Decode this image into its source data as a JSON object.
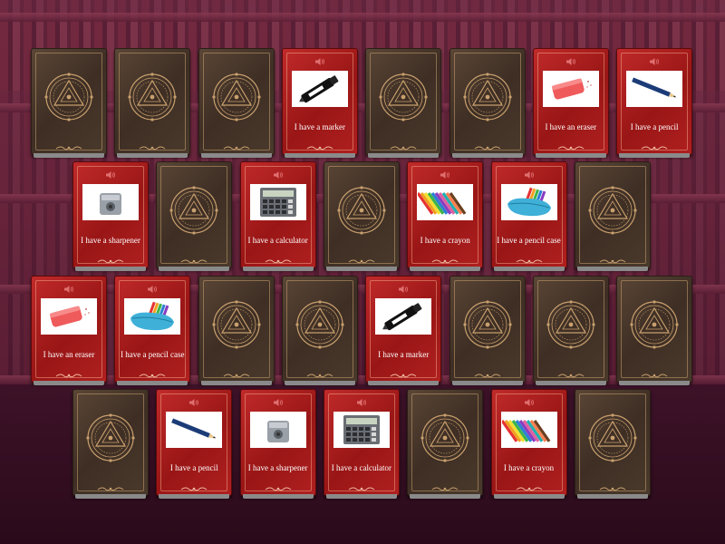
{
  "game": {
    "cards": [
      {
        "row": 0,
        "col": 0,
        "state": "hidden"
      },
      {
        "row": 0,
        "col": 1,
        "state": "hidden"
      },
      {
        "row": 0,
        "col": 2,
        "state": "hidden"
      },
      {
        "row": 0,
        "col": 3,
        "state": "revealed",
        "item": "marker",
        "text": "I have a marker"
      },
      {
        "row": 0,
        "col": 4,
        "state": "hidden"
      },
      {
        "row": 0,
        "col": 5,
        "state": "hidden"
      },
      {
        "row": 0,
        "col": 6,
        "state": "revealed",
        "item": "eraser",
        "text": "I have an eraser"
      },
      {
        "row": 0,
        "col": 7,
        "state": "revealed",
        "item": "pencil",
        "text": "I have a pencil"
      },
      {
        "row": 1,
        "col": 0,
        "state": "revealed",
        "item": "sharpener",
        "text": "I have a sharpener"
      },
      {
        "row": 1,
        "col": 1,
        "state": "hidden"
      },
      {
        "row": 1,
        "col": 2,
        "state": "revealed",
        "item": "calculator",
        "text": "I have a calculator"
      },
      {
        "row": 1,
        "col": 3,
        "state": "hidden"
      },
      {
        "row": 1,
        "col": 4,
        "state": "revealed",
        "item": "crayon",
        "text": "I have a crayon"
      },
      {
        "row": 1,
        "col": 5,
        "state": "revealed",
        "item": "pencil-case",
        "text": "I have a pencil case"
      },
      {
        "row": 1,
        "col": 6,
        "state": "hidden"
      },
      {
        "row": 2,
        "col": 0,
        "state": "revealed",
        "item": "eraser",
        "text": "I have an eraser"
      },
      {
        "row": 2,
        "col": 1,
        "state": "revealed",
        "item": "pencil-case",
        "text": "I have a pencil case"
      },
      {
        "row": 2,
        "col": 2,
        "state": "hidden"
      },
      {
        "row": 2,
        "col": 3,
        "state": "hidden"
      },
      {
        "row": 2,
        "col": 4,
        "state": "revealed",
        "item": "marker",
        "text": "I have a marker"
      },
      {
        "row": 2,
        "col": 5,
        "state": "hidden"
      },
      {
        "row": 2,
        "col": 6,
        "state": "hidden"
      },
      {
        "row": 2,
        "col": 7,
        "state": "hidden"
      },
      {
        "row": 3,
        "col": 0,
        "state": "hidden"
      },
      {
        "row": 3,
        "col": 1,
        "state": "revealed",
        "item": "pencil",
        "text": "I have a pencil"
      },
      {
        "row": 3,
        "col": 2,
        "state": "revealed",
        "item": "sharpener",
        "text": "I have a sharpener"
      },
      {
        "row": 3,
        "col": 3,
        "state": "revealed",
        "item": "calculator",
        "text": "I have a calculator"
      },
      {
        "row": 3,
        "col": 4,
        "state": "hidden"
      },
      {
        "row": 3,
        "col": 5,
        "state": "revealed",
        "item": "crayon",
        "text": "I have a crayon"
      },
      {
        "row": 3,
        "col": 6,
        "state": "hidden"
      }
    ]
  },
  "colors": {
    "card_back": "#4a3a2c",
    "card_front": "#b01e1e",
    "gold": "#c8a06e"
  },
  "icons": {
    "speaker": "speaker-icon",
    "emblem": "occult-circle-emblem",
    "flourish": "ornament-flourish"
  }
}
